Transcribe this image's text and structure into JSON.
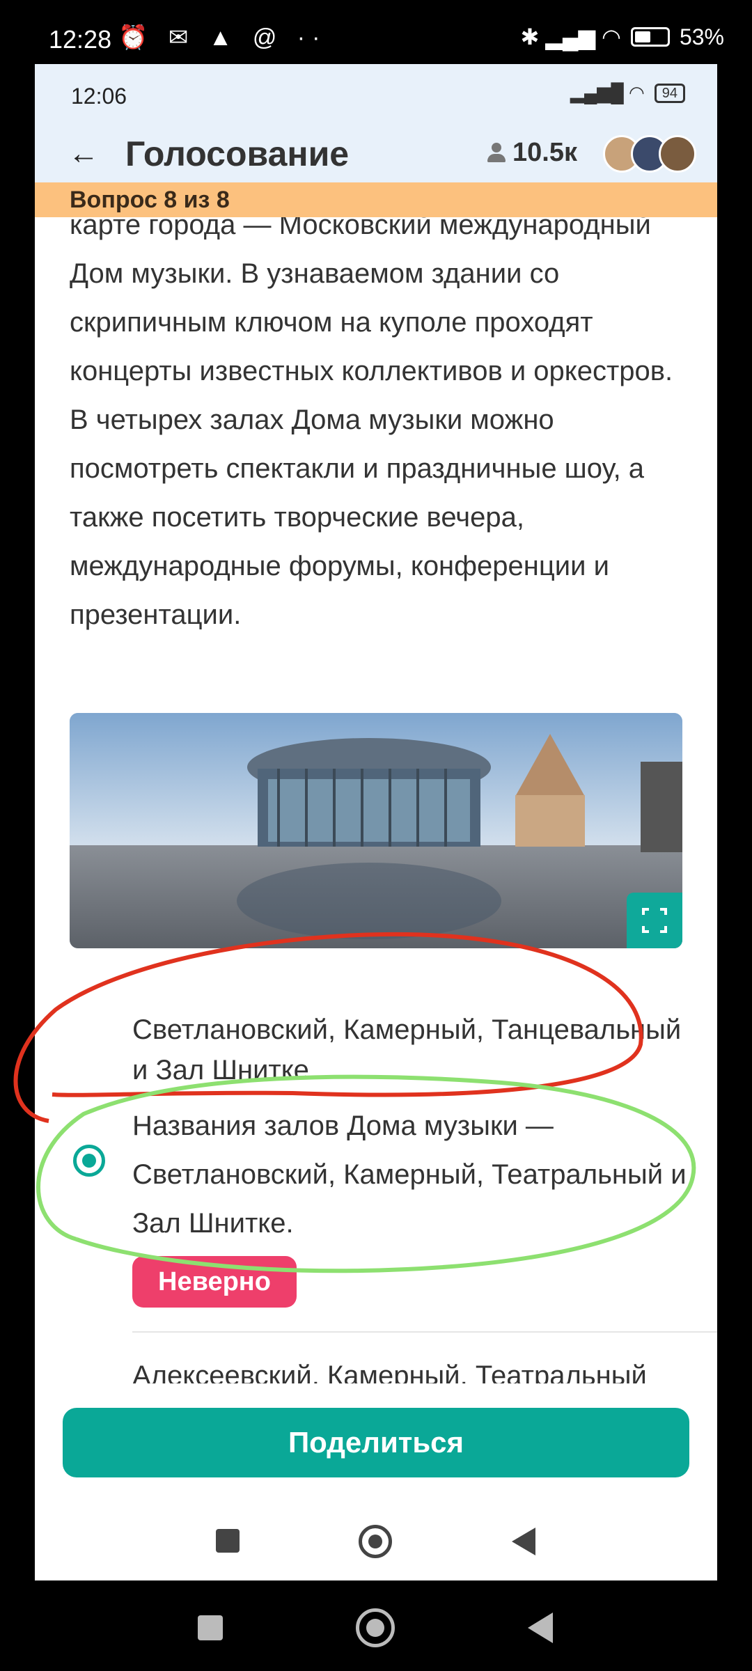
{
  "outer_status": {
    "time": "12:28",
    "left_icons": "⏰ ✉ ▲ @ ··",
    "battery_percent": "53%",
    "right_icons": "✱ ▂▄▆ ◠"
  },
  "inner_status": {
    "time": "12:06",
    "battery": "94",
    "signal": "▂▄▆█ ◠"
  },
  "header": {
    "back_label": "←",
    "title": "Голосование",
    "participants_count": "10.5к"
  },
  "progress": {
    "label": "Вопрос 8 из 8"
  },
  "question": {
    "description": "карте города — Московский международный Дом музыки. В узнаваемом здании со скрипичным ключом на куполе проходят концерты известных коллективов и оркестров. В четырех залах Дома музыки можно посмотреть спектакли и праздничные шоу, а также посетить творческие вечера, международные форумы, конференции и презентации."
  },
  "answers": {
    "option_1": "Светлановский, Камерный, Танцевальный и Зал Шнитке.",
    "option_2": "Названия залов Дома музыки — Светлановский, Камерный, Театральный и Зал Шнитке.",
    "option_3": "Алексеевский, Камерный, Театральный",
    "result_badge": "Неверно"
  },
  "footer": {
    "share_label": "Поделиться"
  },
  "colors": {
    "accent": "#0aa897",
    "progress": "#fcc17e",
    "wrong": "#ee3f6b",
    "annotation_red": "#e0321e",
    "annotation_green": "#8de070"
  }
}
